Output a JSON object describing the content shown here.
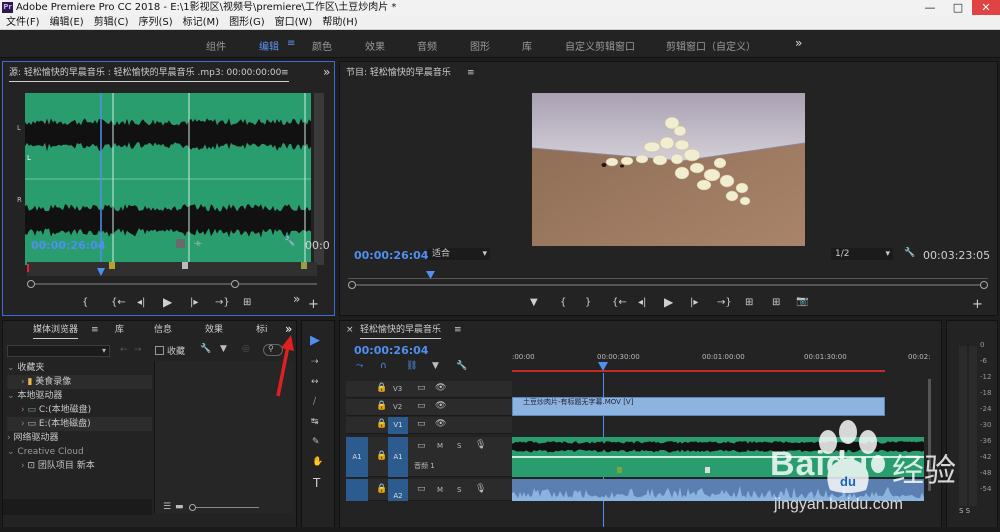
{
  "window": {
    "app_icon": "Pr",
    "title": "Adobe Premiere Pro CC 2018 - E:\\1影视区\\视频号\\premiere\\工作区\\土豆炒肉片 *",
    "min": "—",
    "max": "□",
    "close": "✕"
  },
  "menu": [
    "文件(F)",
    "编辑(E)",
    "剪辑(C)",
    "序列(S)",
    "标记(M)",
    "图形(G)",
    "窗口(W)",
    "帮助(H)"
  ],
  "workspaces": {
    "items": [
      "组件",
      "编辑",
      "颜色",
      "效果",
      "音频",
      "图形",
      "库",
      "自定义剪辑窗口",
      "剪辑窗口（自定义）"
    ],
    "active": "编辑",
    "menu_icon": "≡",
    "more": "»"
  },
  "source": {
    "title": "源: 轻松愉快的早晨音乐 : 轻松愉快的早晨音乐 .mp3: 00:00:00:00",
    "menu": "≡",
    "more": "»",
    "timecode": "00:00:26:04",
    "timecode_right": "00:0",
    "channel_l": "L",
    "channel_r": "R",
    "channel_mid": "L",
    "waveform_color": "#2a9d6f",
    "controls": [
      "{",
      "{←",
      "◂|",
      "▶",
      "|▸",
      "→}",
      "⊞"
    ],
    "more2": "»",
    "add": "+"
  },
  "program": {
    "title": "节目: 轻松愉快的早晨音乐",
    "menu": "≡",
    "timecode": "00:00:26:04",
    "fit": "适合",
    "fit_arrow": "▾",
    "quality": "1/2",
    "quality_arrow": "▾",
    "timecode_right": "00:03:23:05",
    "controls": [
      "▼",
      "{",
      "}",
      "{←",
      "◂|",
      "▶",
      "|▸",
      "→}",
      "⊞",
      "⊞",
      "📷"
    ],
    "add": "+"
  },
  "media_browser": {
    "tabs": [
      "媒体浏览器",
      "库",
      "信息",
      "效果",
      "标i"
    ],
    "menu": "≡",
    "more": "»",
    "favorites_label": "收藏",
    "tree": [
      {
        "label": "收藏夹",
        "indent": 0
      },
      {
        "label": "美食录像",
        "indent": 1
      },
      {
        "label": "本地驱动器",
        "indent": 0
      },
      {
        "label": "C:(本地磁盘)",
        "indent": 1
      },
      {
        "label": "E:(本地磁盘)",
        "indent": 1
      },
      {
        "label": "网络驱动器",
        "indent": 0
      },
      {
        "label": "Creative Cloud",
        "indent": 0
      },
      {
        "label": "团队项目 新本",
        "indent": 1
      }
    ]
  },
  "tools": [
    "▶",
    "⇢",
    "↔",
    "⧸",
    "↹",
    "✎",
    "✋",
    "T"
  ],
  "timeline": {
    "close": "×",
    "title": "轻松愉快的早晨音乐",
    "menu": "≡",
    "timecode": "00:00:26:04",
    "ruler": [
      ":00:00",
      "00:00:30:00",
      "00:01:00:00",
      "00:01:30:00",
      "00:02:"
    ],
    "tracks_video": [
      "V3",
      "V2",
      "V1"
    ],
    "tracks_audio": [
      "A1",
      "A2"
    ],
    "audio_src": "A1",
    "clip_video": "土豆炒肉片-有标题无字幕.MOV [V]",
    "audio_track_label": "音频 1",
    "btn_m": "M",
    "btn_s": "S"
  },
  "meter": {
    "ticks": [
      "0",
      "-6",
      "-12",
      "-18",
      "-24",
      "-30",
      "-36",
      "-42",
      "-48",
      "-54"
    ],
    "dash": "-",
    "ss": "S S"
  },
  "watermark": {
    "brand": "Baidu",
    "sub": "经验",
    "url": "jingyan.baidu.com"
  }
}
